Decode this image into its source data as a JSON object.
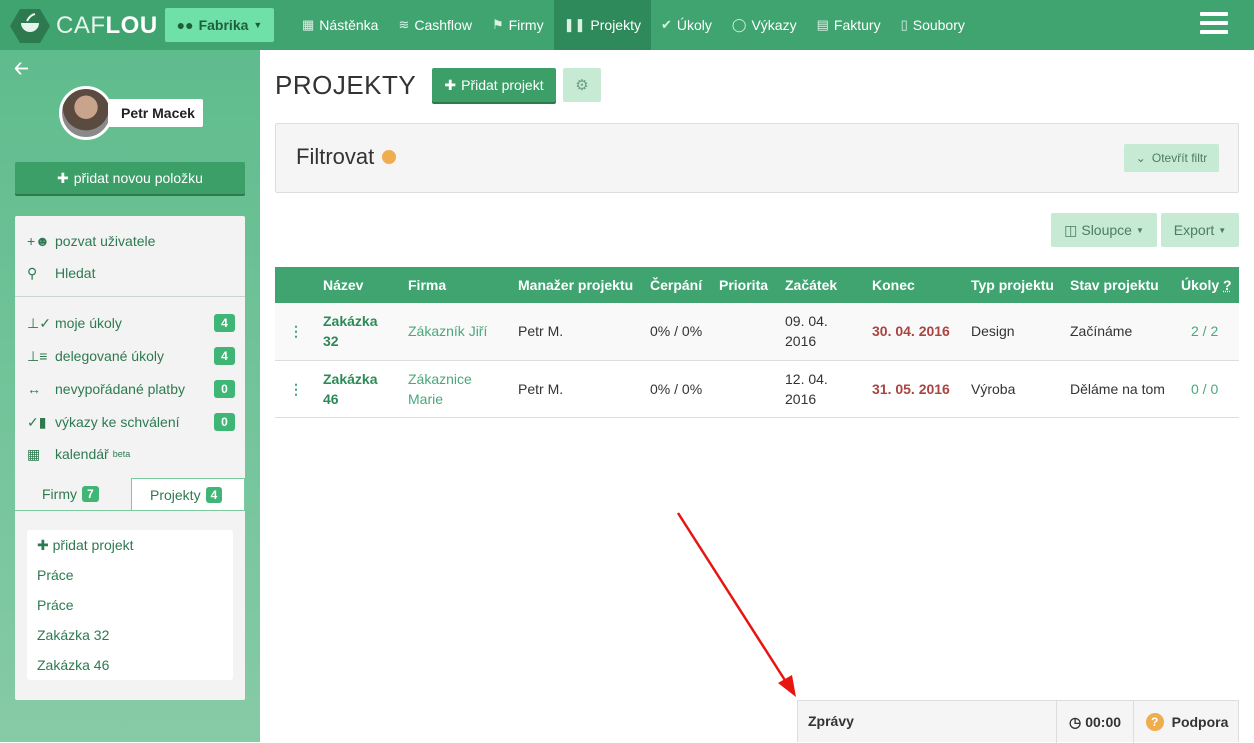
{
  "brand": {
    "light": "CAF",
    "bold": "LOU"
  },
  "org_button": {
    "label": "Fabrika"
  },
  "nav": [
    {
      "label": "Nástěnka",
      "icon": "dashboard-icon"
    },
    {
      "label": "Cashflow",
      "icon": "cashflow-icon"
    },
    {
      "label": "Firmy",
      "icon": "flag-icon"
    },
    {
      "label": "Projekty",
      "icon": "columns-icon",
      "active": true
    },
    {
      "label": "Úkoly",
      "icon": "check-icon"
    },
    {
      "label": "Výkazy",
      "icon": "stopwatch-icon"
    },
    {
      "label": "Faktury",
      "icon": "invoice-icon"
    },
    {
      "label": "Soubory",
      "icon": "file-icon"
    }
  ],
  "sidebar": {
    "user_name": "Petr Macek",
    "add_item_label": "přidat novou položku",
    "menu": [
      {
        "label": "pozvat uživatele",
        "icon": "add-user-icon"
      },
      {
        "label": "Hledat",
        "icon": "search-icon"
      },
      {
        "label": "moje úkoly",
        "icon": "my-tasks-icon",
        "badge": "4"
      },
      {
        "label": "delegované úkoly",
        "icon": "delegated-tasks-icon",
        "badge": "4"
      },
      {
        "label": "nevypořádané platby",
        "icon": "payments-icon",
        "badge": "0"
      },
      {
        "label": "výkazy ke schválení",
        "icon": "reports-icon",
        "badge": "0"
      },
      {
        "label": "kalendář",
        "icon": "calendar-icon",
        "sup": "beta"
      }
    ],
    "tabs": [
      {
        "label": "Firmy",
        "badge": "7"
      },
      {
        "label": "Projekty",
        "badge": "4",
        "active": true
      }
    ],
    "projects": [
      "přidat projekt",
      "Práce",
      "Práce",
      "Zakázka 32",
      "Zakázka 46"
    ]
  },
  "main": {
    "title": "PROJEKTY",
    "add_project_label": "Přidat projekt",
    "filter_title": "Filtrovat",
    "open_filter_label": "Otevřít filtr",
    "columns_label": "Sloupce",
    "export_label": "Export",
    "table": {
      "headers": [
        "Název",
        "Firma",
        "Manažer projektu",
        "Čerpání",
        "Priorita",
        "Začátek",
        "Konec",
        "Typ projektu",
        "Stav projektu",
        "Úkoly",
        "?"
      ],
      "rows": [
        {
          "name_1": "Zakázka",
          "name_2": "32",
          "firm_1": "Zákazník Jiří",
          "firm_2": "",
          "manager": "Petr M.",
          "usage": "0% / 0%",
          "priority": "",
          "start_1": "09. 04.",
          "start_2": "2016",
          "end": "30. 04. 2016",
          "type": "Design",
          "status": "Začínáme",
          "tasks": "2 / 2"
        },
        {
          "name_1": "Zakázka",
          "name_2": "46",
          "firm_1": "Zákaznice",
          "firm_2": "Marie",
          "manager": "Petr M.",
          "usage": "0% / 0%",
          "priority": "",
          "start_1": "12. 04.",
          "start_2": "2016",
          "end": "31. 05. 2016",
          "type": "Výroba",
          "status": "Děláme na tom",
          "tasks": "0 / 0"
        }
      ]
    }
  },
  "bottom_bar": {
    "messages": "Zprávy",
    "timer": "00:00",
    "support": "Podpora"
  },
  "colors": {
    "primary": "#3fa470",
    "accent_light": "#c7ead5",
    "danger": "#a94442",
    "warning": "#f0ad4e"
  }
}
